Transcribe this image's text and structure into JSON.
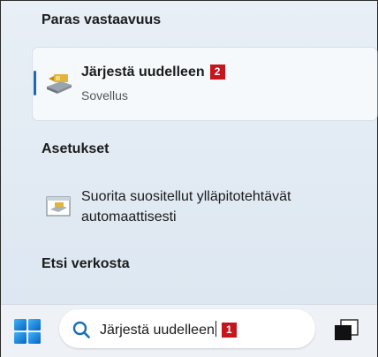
{
  "sections": {
    "best_match": "Paras vastaavuus",
    "settings": "Asetukset",
    "web": "Etsi verkosta"
  },
  "best_result": {
    "title": "Järjestä uudelleen",
    "badge": "2",
    "subtitle": "Sovellus",
    "icon": "defrag-app-icon"
  },
  "setting_result": {
    "text": "Suorita suositellut ylläpitotehtävät automaattisesti",
    "icon": "maintenance-icon"
  },
  "taskbar": {
    "search_value": "Järjestä uudelleen",
    "badge": "1",
    "start_icon": "windows-start-icon",
    "search_icon": "search-icon",
    "taskview_icon": "task-view-icon"
  },
  "colors": {
    "accent": "#1f64b6",
    "badge": "#c4161c",
    "panel": "#e4ecf4"
  }
}
